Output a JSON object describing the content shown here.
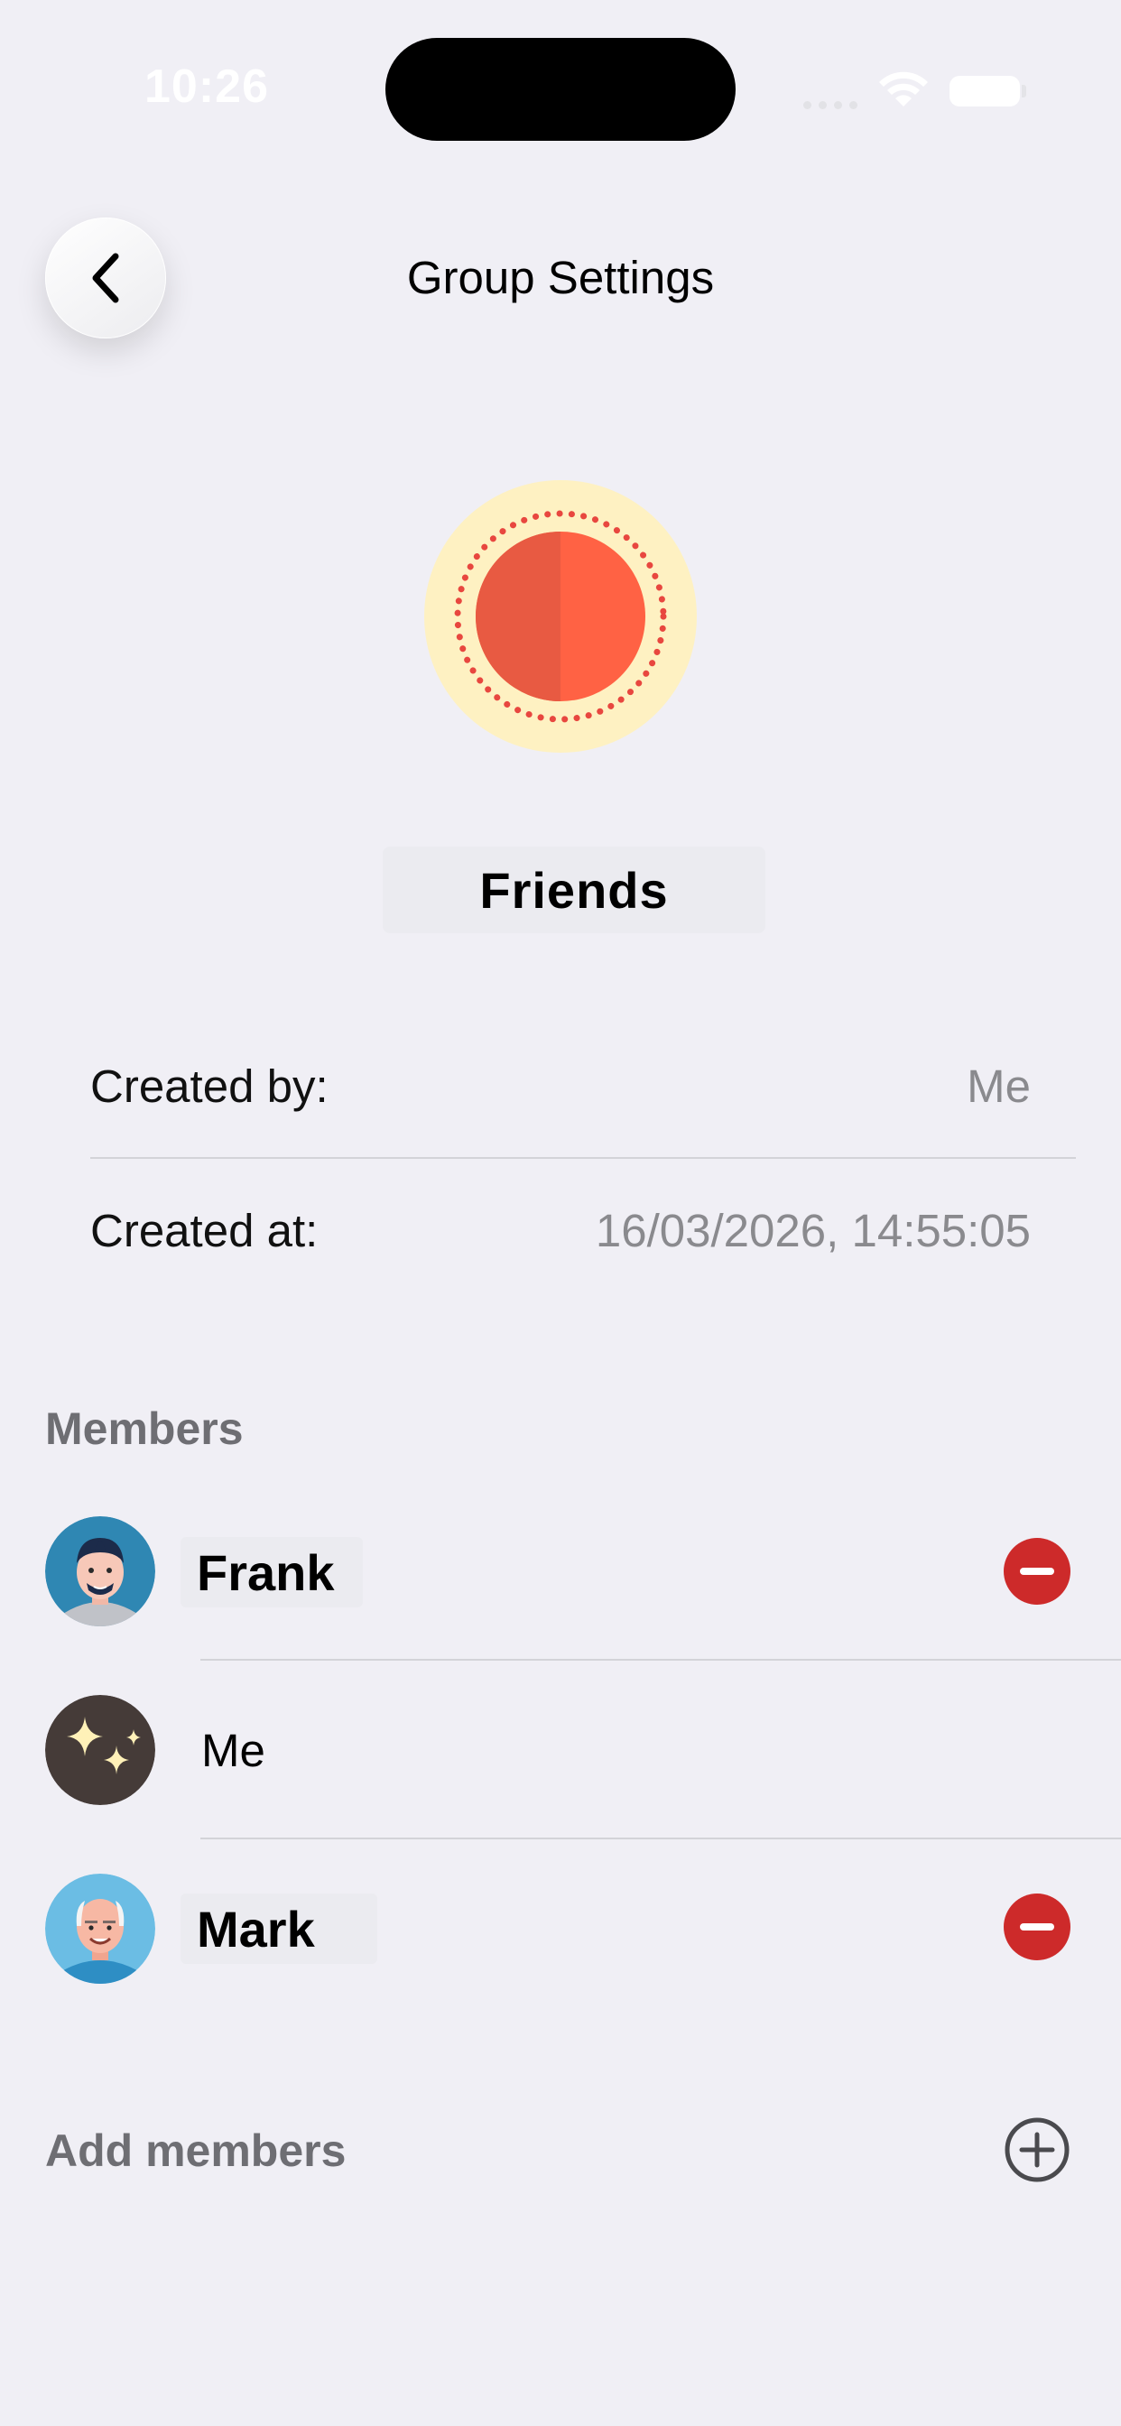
{
  "status_bar": {
    "time": "10:26"
  },
  "header": {
    "title": "Group Settings",
    "back_icon": "chevron-left-icon"
  },
  "group": {
    "name": "Friends",
    "avatar_colors": {
      "outer": "#fef1c2",
      "dots": "#e8473f",
      "inner_left": "#e85a42",
      "inner_right": "#ff6244"
    }
  },
  "info": {
    "created_by_label": "Created by:",
    "created_by_value": "Me",
    "created_at_label": "Created at:",
    "created_at_value": "16/03/2026, 14:55:05"
  },
  "members": {
    "header": "Members",
    "items": [
      {
        "name": "Frank",
        "avatar": "man-avatar-icon",
        "removable": true
      },
      {
        "name": "Me",
        "avatar": "sparkles-icon",
        "removable": false
      },
      {
        "name": "Mark",
        "avatar": "old-man-avatar-icon",
        "removable": true
      }
    ],
    "remove_icon": "minus-circle-icon",
    "remove_color": "#cd2a2a"
  },
  "add_members": {
    "label": "Add members",
    "icon": "plus-circle-icon"
  }
}
